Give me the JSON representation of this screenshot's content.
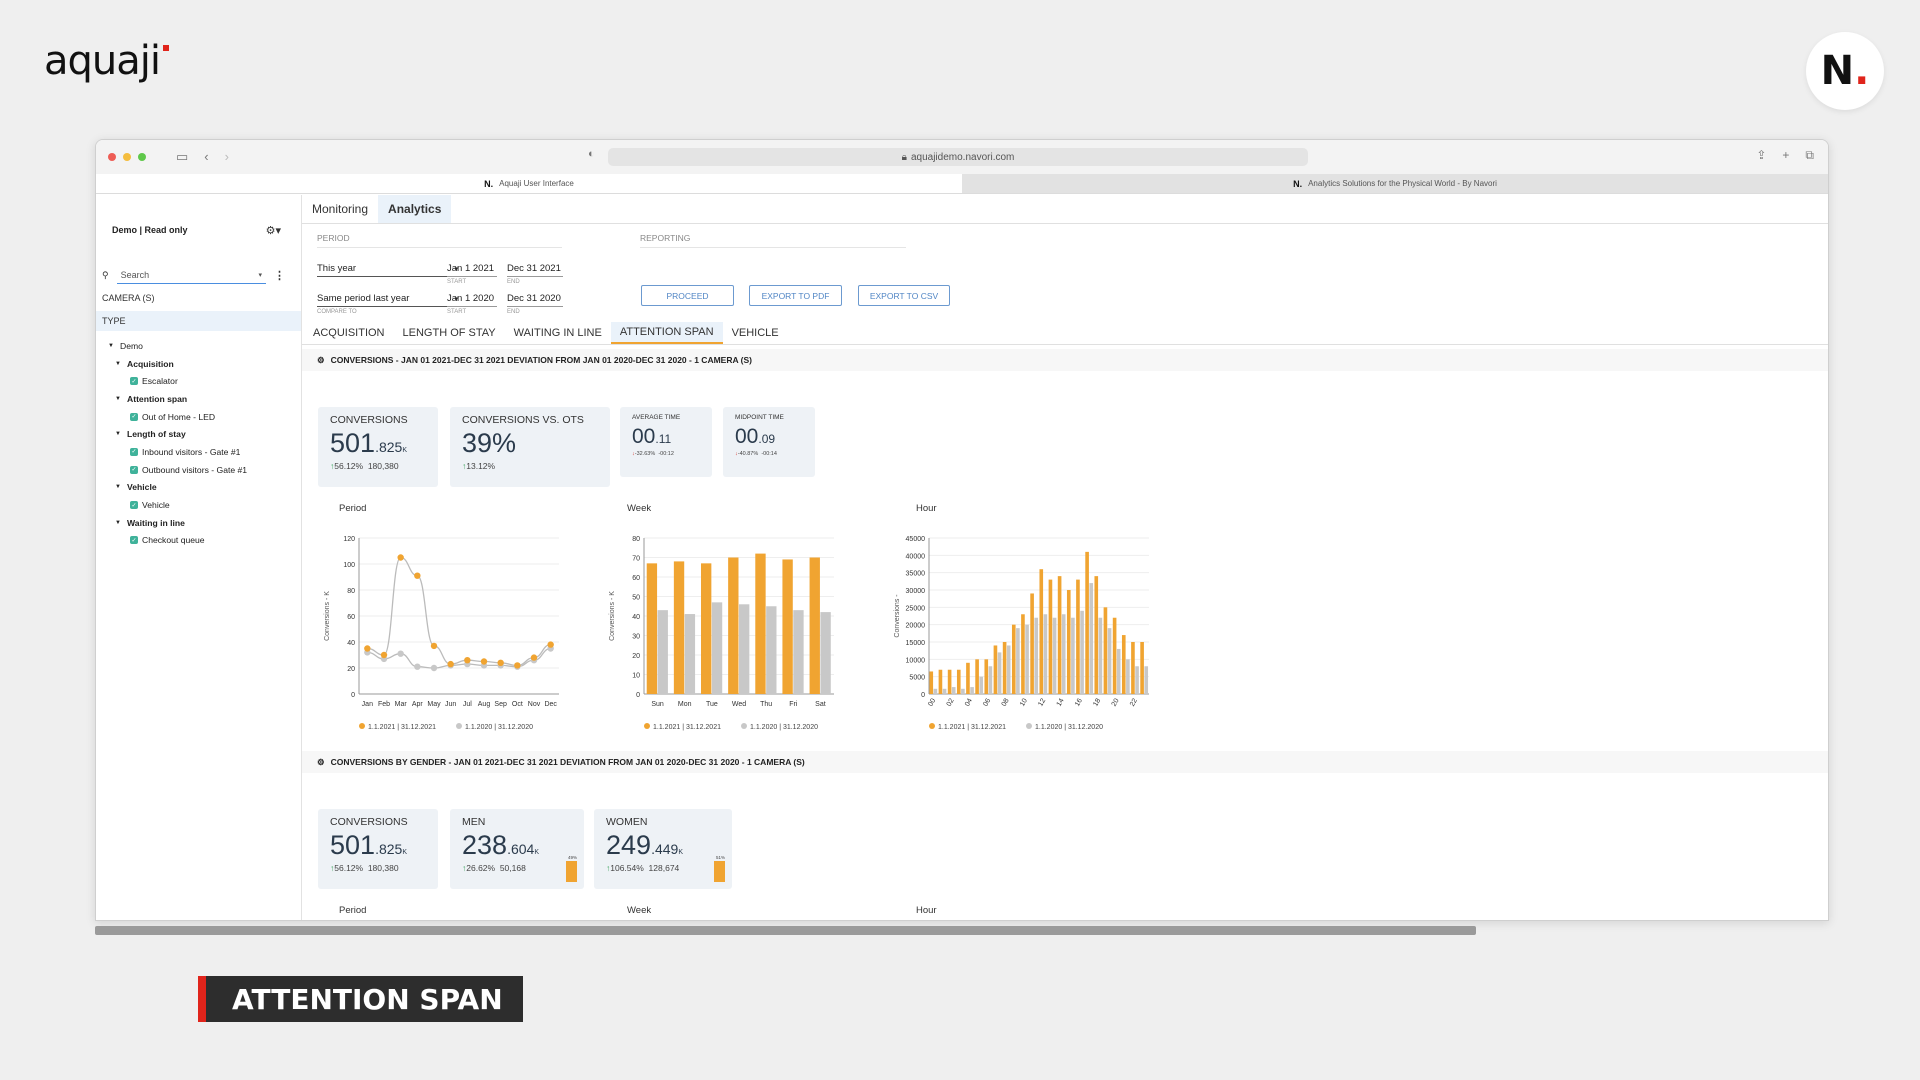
{
  "brand": {
    "logo_text": "aquaji",
    "navori_mark": "N",
    "navori_dot": "."
  },
  "caption": "ATTENTION SPAN",
  "browser": {
    "url": "aquajidemo.navori.com",
    "tabs": [
      {
        "icon": "N.",
        "label": "Aquaji User Interface"
      },
      {
        "icon": "N.",
        "label": "Analytics Solutions for the Physical World - By Navori"
      }
    ]
  },
  "sidebar": {
    "title": "Demo | Read only",
    "search_placeholder": "Search",
    "camera_label": "CAMERA (S)",
    "type_label": "TYPE",
    "tree": [
      {
        "level": 1,
        "label": "Demo"
      },
      {
        "level": 2,
        "label": "Acquisition"
      },
      {
        "level": 3,
        "label": "Escalator"
      },
      {
        "level": 2,
        "label": "Attention span"
      },
      {
        "level": 3,
        "label": "Out of Home - LED"
      },
      {
        "level": 2,
        "label": "Length of stay"
      },
      {
        "level": 3,
        "label": "Inbound visitors - Gate #1"
      },
      {
        "level": 3,
        "label": "Outbound visitors - Gate #1"
      },
      {
        "level": 2,
        "label": "Vehicle"
      },
      {
        "level": 3,
        "label": "Vehicle"
      },
      {
        "level": 2,
        "label": "Waiting in line"
      },
      {
        "level": 3,
        "label": "Checkout queue"
      }
    ]
  },
  "main": {
    "top_tabs": [
      "Monitoring",
      "Analytics"
    ],
    "period_label": "PERIOD",
    "reporting_label": "REPORTING",
    "period_select": "This year",
    "period_start": "Jan 1 2021",
    "period_end": "Dec 31 2021",
    "compare_select": "Same period last year",
    "compare_label": "COMPARE TO",
    "compare_start": "Jan 1 2020",
    "compare_end": "Dec 31 2020",
    "start_label": "START",
    "end_label": "END",
    "buttons": {
      "proceed": "PROCEED",
      "pdf": "EXPORT TO PDF",
      "csv": "EXPORT TO CSV"
    },
    "sub_tabs": [
      "ACQUISITION",
      "LENGTH OF STAY",
      "WAITING IN LINE",
      "ATTENTION SPAN",
      "VEHICLE"
    ],
    "section1_title": "CONVERSIONS - JAN 01 2021-DEC 31 2021 DEVIATION FROM JAN 01 2020-DEC 31 2020 - 1 CAMERA (S)",
    "section2_title": "CONVERSIONS BY GENDER - JAN 01 2021-DEC 31 2021 DEVIATION FROM JAN 01 2020-DEC 31 2020 - 1 CAMERA (S)",
    "kpis1": {
      "conversions": {
        "label": "CONVERSIONS",
        "main": "501",
        "decimal": ".825",
        "unit": "K",
        "delta": "56.12%",
        "prev": "180,380"
      },
      "vs_ots": {
        "label": "CONVERSIONS VS. OTS",
        "main": "39%",
        "delta": "13.12%"
      },
      "avg_time": {
        "label": "AVERAGE TIME",
        "main": "00",
        "decimal": ".11",
        "delta": "-32.63%",
        "prev": "-00:12"
      },
      "midpoint": {
        "label": "MIDPOINT TIME",
        "main": "00",
        "decimal": ".09",
        "delta": "-40.87%",
        "prev": "-00:14"
      }
    },
    "kpis2": {
      "conversions": {
        "label": "CONVERSIONS",
        "main": "501",
        "decimal": ".825",
        "unit": "K",
        "delta": "56.12%",
        "prev": "180,380"
      },
      "men": {
        "label": "MEN",
        "main": "238",
        "decimal": ".604",
        "unit": "K",
        "delta": "26.62%",
        "prev": "50,168",
        "share": "49%",
        "share_value": 0.49
      },
      "women": {
        "label": "WOMEN",
        "main": "249",
        "decimal": ".449",
        "unit": "K",
        "delta": "106.54%",
        "prev": "128,674",
        "share": "51%",
        "share_value": 0.51
      }
    },
    "chart_titles": {
      "period": "Period",
      "week": "Week",
      "hour": "Hour"
    },
    "legend": {
      "current": "1.1.2021 | 31.12.2021",
      "previous": "1.1.2020 | 31.12.2020"
    },
    "colors": {
      "current": "#f0a431",
      "previous": "#c8c8c8",
      "accent": "#4a8ee0"
    }
  },
  "chart_data": [
    {
      "type": "line",
      "title": "Period",
      "ylabel": "Conversions - K",
      "ylim": [
        0,
        120
      ],
      "yticks": [
        0,
        20,
        40,
        60,
        80,
        100,
        120
      ],
      "categories": [
        "Jan",
        "Feb",
        "Mar",
        "Apr",
        "May",
        "Jun",
        "Jul",
        "Aug",
        "Sep",
        "Oct",
        "Nov",
        "Dec"
      ],
      "series": [
        {
          "name": "1.1.2021 | 31.12.2021",
          "values": [
            35,
            30,
            105,
            91,
            37,
            23,
            26,
            25,
            24,
            22,
            28,
            38
          ]
        },
        {
          "name": "1.1.2020 | 31.12.2020",
          "values": [
            32,
            27,
            31,
            21,
            20,
            22,
            23,
            22,
            22,
            21,
            26,
            35
          ]
        }
      ]
    },
    {
      "type": "bar",
      "title": "Week",
      "ylabel": "Conversions - K",
      "ylim": [
        0,
        80
      ],
      "yticks": [
        0,
        10,
        20,
        30,
        40,
        50,
        60,
        70,
        80
      ],
      "categories": [
        "Sun",
        "Mon",
        "Tue",
        "Wed",
        "Thu",
        "Fri",
        "Sat"
      ],
      "series": [
        {
          "name": "1.1.2021 | 31.12.2021",
          "values": [
            67,
            68,
            67,
            70,
            72,
            69,
            70
          ]
        },
        {
          "name": "1.1.2020 | 31.12.2020",
          "values": [
            43,
            41,
            47,
            46,
            45,
            43,
            42
          ]
        }
      ]
    },
    {
      "type": "bar",
      "title": "Hour",
      "ylabel": "Conversions -",
      "ylim": [
        0,
        45000
      ],
      "yticks": [
        0,
        5000,
        10000,
        15000,
        20000,
        25000,
        30000,
        35000,
        40000,
        45000
      ],
      "categories": [
        "00",
        "01",
        "02",
        "03",
        "04",
        "05",
        "06",
        "07",
        "08",
        "09",
        "10",
        "11",
        "12",
        "13",
        "14",
        "15",
        "16",
        "17",
        "18",
        "19",
        "20",
        "21",
        "22",
        "23"
      ],
      "tick_labels": [
        "00",
        "02",
        "04",
        "06",
        "08",
        "10",
        "12",
        "14",
        "16",
        "18",
        "20",
        "22"
      ],
      "series": [
        {
          "name": "1.1.2021 | 31.12.2021",
          "values": [
            6500,
            7000,
            7000,
            7000,
            9000,
            10000,
            10000,
            14000,
            15000,
            20000,
            23000,
            29000,
            36000,
            33000,
            34000,
            30000,
            33000,
            41000,
            34000,
            25000,
            22000,
            17000,
            15000,
            15000
          ]
        },
        {
          "name": "1.1.2020 | 31.12.2020",
          "values": [
            1500,
            1500,
            2000,
            1500,
            2000,
            5000,
            8000,
            12000,
            14000,
            19000,
            20000,
            22000,
            23000,
            22000,
            23000,
            22000,
            24000,
            32000,
            22000,
            19000,
            13000,
            10000,
            8000,
            8000
          ]
        }
      ]
    }
  ]
}
